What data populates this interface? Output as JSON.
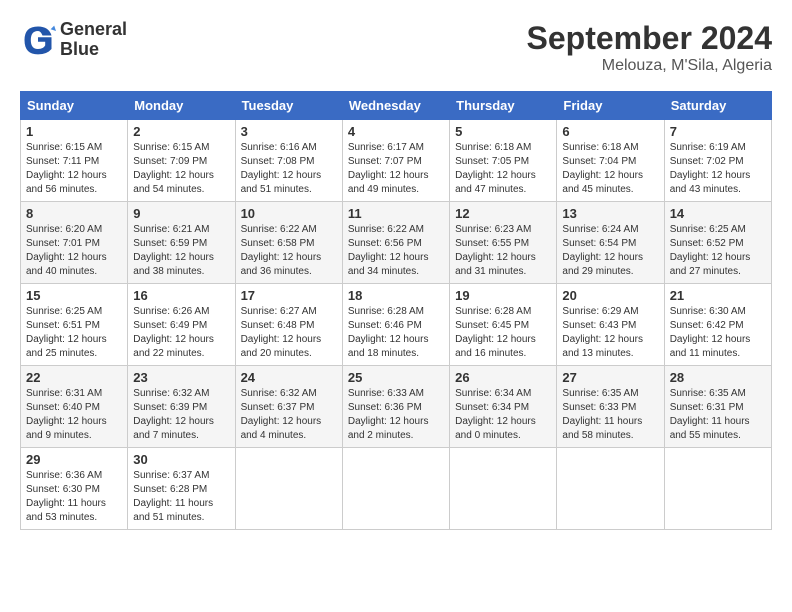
{
  "header": {
    "logo": {
      "line1": "General",
      "line2": "Blue"
    },
    "title": "September 2024",
    "subtitle": "Melouza, M'Sila, Algeria"
  },
  "weekdays": [
    "Sunday",
    "Monday",
    "Tuesday",
    "Wednesday",
    "Thursday",
    "Friday",
    "Saturday"
  ],
  "weeks": [
    [
      {
        "day": "1",
        "info": "Sunrise: 6:15 AM\nSunset: 7:11 PM\nDaylight: 12 hours\nand 56 minutes."
      },
      {
        "day": "2",
        "info": "Sunrise: 6:15 AM\nSunset: 7:09 PM\nDaylight: 12 hours\nand 54 minutes."
      },
      {
        "day": "3",
        "info": "Sunrise: 6:16 AM\nSunset: 7:08 PM\nDaylight: 12 hours\nand 51 minutes."
      },
      {
        "day": "4",
        "info": "Sunrise: 6:17 AM\nSunset: 7:07 PM\nDaylight: 12 hours\nand 49 minutes."
      },
      {
        "day": "5",
        "info": "Sunrise: 6:18 AM\nSunset: 7:05 PM\nDaylight: 12 hours\nand 47 minutes."
      },
      {
        "day": "6",
        "info": "Sunrise: 6:18 AM\nSunset: 7:04 PM\nDaylight: 12 hours\nand 45 minutes."
      },
      {
        "day": "7",
        "info": "Sunrise: 6:19 AM\nSunset: 7:02 PM\nDaylight: 12 hours\nand 43 minutes."
      }
    ],
    [
      {
        "day": "8",
        "info": "Sunrise: 6:20 AM\nSunset: 7:01 PM\nDaylight: 12 hours\nand 40 minutes."
      },
      {
        "day": "9",
        "info": "Sunrise: 6:21 AM\nSunset: 6:59 PM\nDaylight: 12 hours\nand 38 minutes."
      },
      {
        "day": "10",
        "info": "Sunrise: 6:22 AM\nSunset: 6:58 PM\nDaylight: 12 hours\nand 36 minutes."
      },
      {
        "day": "11",
        "info": "Sunrise: 6:22 AM\nSunset: 6:56 PM\nDaylight: 12 hours\nand 34 minutes."
      },
      {
        "day": "12",
        "info": "Sunrise: 6:23 AM\nSunset: 6:55 PM\nDaylight: 12 hours\nand 31 minutes."
      },
      {
        "day": "13",
        "info": "Sunrise: 6:24 AM\nSunset: 6:54 PM\nDaylight: 12 hours\nand 29 minutes."
      },
      {
        "day": "14",
        "info": "Sunrise: 6:25 AM\nSunset: 6:52 PM\nDaylight: 12 hours\nand 27 minutes."
      }
    ],
    [
      {
        "day": "15",
        "info": "Sunrise: 6:25 AM\nSunset: 6:51 PM\nDaylight: 12 hours\nand 25 minutes."
      },
      {
        "day": "16",
        "info": "Sunrise: 6:26 AM\nSunset: 6:49 PM\nDaylight: 12 hours\nand 22 minutes."
      },
      {
        "day": "17",
        "info": "Sunrise: 6:27 AM\nSunset: 6:48 PM\nDaylight: 12 hours\nand 20 minutes."
      },
      {
        "day": "18",
        "info": "Sunrise: 6:28 AM\nSunset: 6:46 PM\nDaylight: 12 hours\nand 18 minutes."
      },
      {
        "day": "19",
        "info": "Sunrise: 6:28 AM\nSunset: 6:45 PM\nDaylight: 12 hours\nand 16 minutes."
      },
      {
        "day": "20",
        "info": "Sunrise: 6:29 AM\nSunset: 6:43 PM\nDaylight: 12 hours\nand 13 minutes."
      },
      {
        "day": "21",
        "info": "Sunrise: 6:30 AM\nSunset: 6:42 PM\nDaylight: 12 hours\nand 11 minutes."
      }
    ],
    [
      {
        "day": "22",
        "info": "Sunrise: 6:31 AM\nSunset: 6:40 PM\nDaylight: 12 hours\nand 9 minutes."
      },
      {
        "day": "23",
        "info": "Sunrise: 6:32 AM\nSunset: 6:39 PM\nDaylight: 12 hours\nand 7 minutes."
      },
      {
        "day": "24",
        "info": "Sunrise: 6:32 AM\nSunset: 6:37 PM\nDaylight: 12 hours\nand 4 minutes."
      },
      {
        "day": "25",
        "info": "Sunrise: 6:33 AM\nSunset: 6:36 PM\nDaylight: 12 hours\nand 2 minutes."
      },
      {
        "day": "26",
        "info": "Sunrise: 6:34 AM\nSunset: 6:34 PM\nDaylight: 12 hours\nand 0 minutes."
      },
      {
        "day": "27",
        "info": "Sunrise: 6:35 AM\nSunset: 6:33 PM\nDaylight: 11 hours\nand 58 minutes."
      },
      {
        "day": "28",
        "info": "Sunrise: 6:35 AM\nSunset: 6:31 PM\nDaylight: 11 hours\nand 55 minutes."
      }
    ],
    [
      {
        "day": "29",
        "info": "Sunrise: 6:36 AM\nSunset: 6:30 PM\nDaylight: 11 hours\nand 53 minutes."
      },
      {
        "day": "30",
        "info": "Sunrise: 6:37 AM\nSunset: 6:28 PM\nDaylight: 11 hours\nand 51 minutes."
      },
      {
        "day": "",
        "info": ""
      },
      {
        "day": "",
        "info": ""
      },
      {
        "day": "",
        "info": ""
      },
      {
        "day": "",
        "info": ""
      },
      {
        "day": "",
        "info": ""
      }
    ]
  ]
}
